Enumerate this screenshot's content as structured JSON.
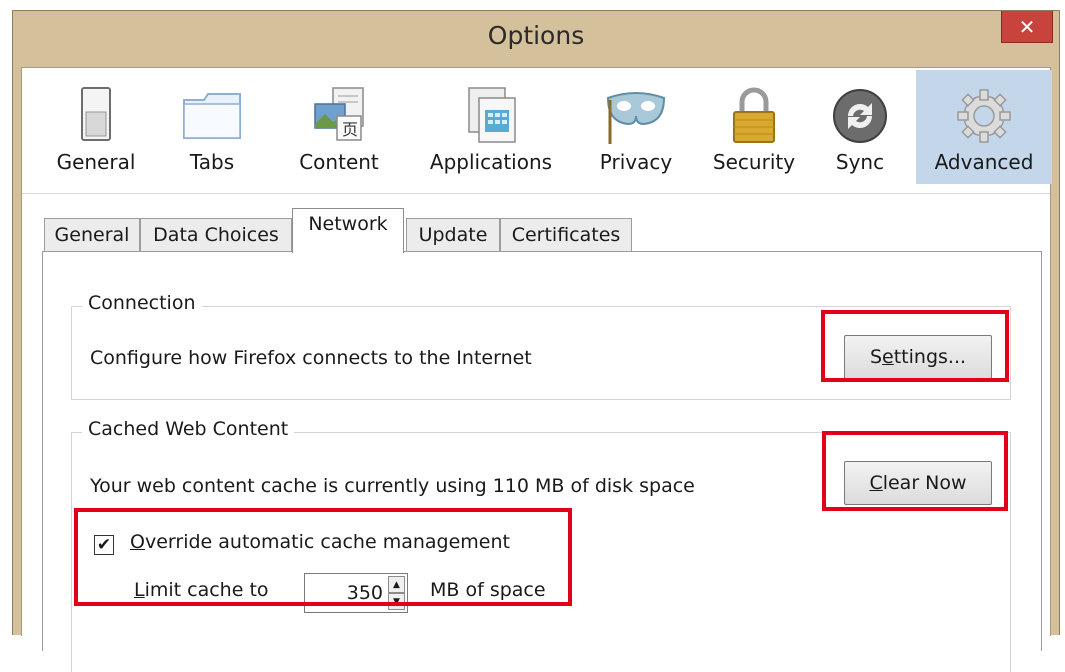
{
  "window": {
    "title": "Options",
    "close_glyph": "✕"
  },
  "toolbar": {
    "items": [
      {
        "label": "General",
        "icon": "switch-icon"
      },
      {
        "label": "Tabs",
        "icon": "tabs-icon"
      },
      {
        "label": "Content",
        "icon": "content-icon"
      },
      {
        "label": "Applications",
        "icon": "applications-icon"
      },
      {
        "label": "Privacy",
        "icon": "mask-icon"
      },
      {
        "label": "Security",
        "icon": "padlock-icon"
      },
      {
        "label": "Sync",
        "icon": "sync-icon"
      },
      {
        "label": "Advanced",
        "icon": "gear-icon",
        "selected": true
      }
    ]
  },
  "tabs": {
    "items": [
      {
        "label": "General"
      },
      {
        "label": "Data Choices"
      },
      {
        "label": "Network",
        "active": true
      },
      {
        "label": "Update"
      },
      {
        "label": "Certificates"
      }
    ]
  },
  "connection": {
    "title": "Connection",
    "description": "Configure how Firefox connects to the Internet",
    "settings_button": {
      "prefix": "S",
      "accel": "e",
      "rest": "ttings..."
    }
  },
  "cache": {
    "title": "Cached Web Content",
    "description": "Your web content cache is currently using 110 MB of disk space",
    "clear_button": {
      "accel": "C",
      "rest": "lear Now"
    },
    "override": {
      "accel": "O",
      "rest": "verride automatic cache management",
      "checked": true,
      "check_glyph": "✔"
    },
    "limit": {
      "accel": "L",
      "rest": "imit cache to",
      "value": "350",
      "unit": "MB of space"
    }
  },
  "colors": {
    "highlight": "#e3001b",
    "selected_tab_bg": "#c3d6ea",
    "titlebar": "#d4c09a",
    "close": "#c7433c"
  }
}
